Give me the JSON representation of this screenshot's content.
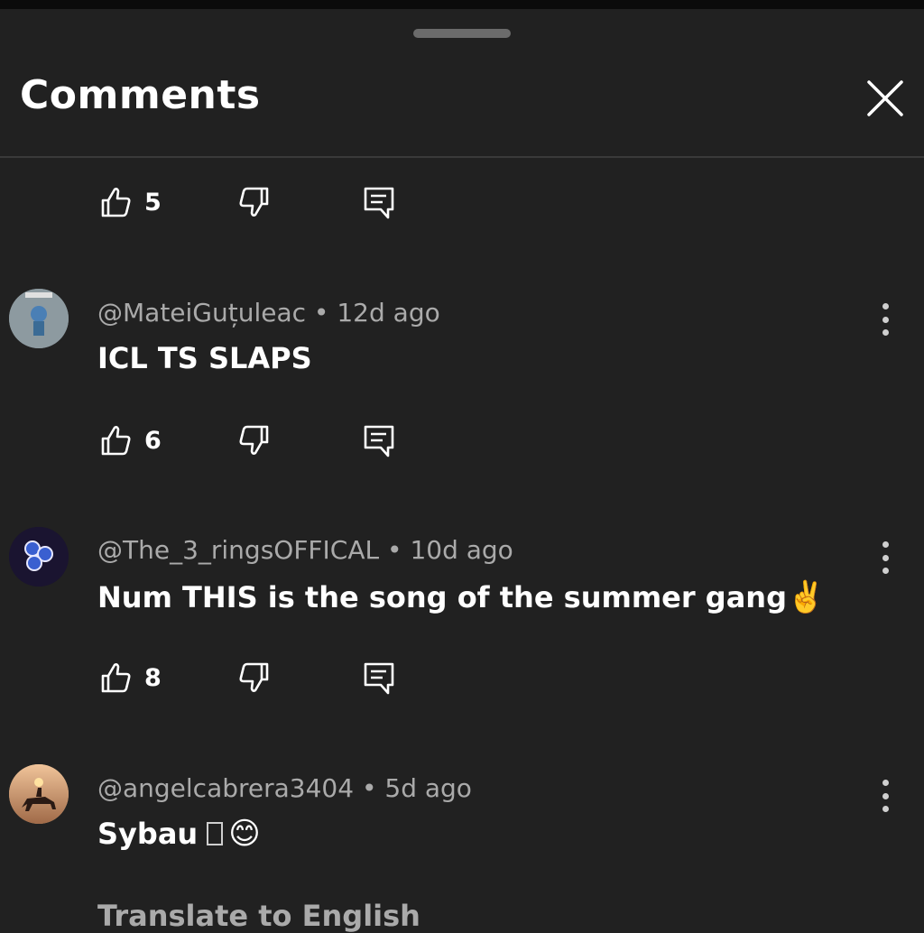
{
  "header": {
    "title": "Comments"
  },
  "icons": {
    "close": "close-icon",
    "like": "thumbs-up-icon",
    "dislike": "thumbs-down-icon",
    "reply": "reply-icon",
    "more": "more-vert-icon"
  },
  "colors": {
    "background": "#212121",
    "text": "#ffffff",
    "meta": "#aaaaaa",
    "divider": "#3a3a3a"
  },
  "top_partial_comment": {
    "likes": "5"
  },
  "comments": [
    {
      "username": "@MateiGuțuleac",
      "separator": " • ",
      "time": "12d ago",
      "text": "ICL TS SLAPS",
      "likes": "6"
    },
    {
      "username": "@The_3_ringsOFFICAL",
      "separator": " • ",
      "time": "10d ago",
      "text": "Num THIS is the song of the summer gang",
      "emoji": "✌️",
      "likes": "8"
    },
    {
      "username": "@angelcabrera3404",
      "separator": " • ",
      "time": "5d ago",
      "text": "Sybau",
      "emoji": "😊",
      "translate_label": "Translate to English"
    }
  ]
}
